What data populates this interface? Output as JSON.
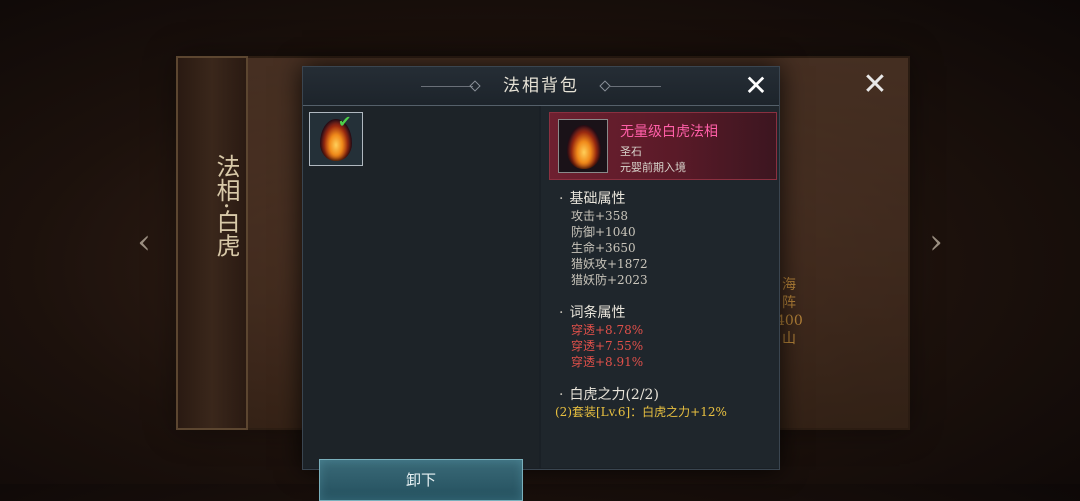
{
  "background": {
    "scroll_title": "法相·白虎",
    "side_text": "海阵400山"
  },
  "dialog": {
    "title": "法相背包",
    "unequip_label": "卸下"
  },
  "item": {
    "name": "无量级白虎法相",
    "type": "圣石",
    "requirement": "元婴前期入境",
    "name_color": "#ff5fa8"
  },
  "base_attributes": {
    "title": "基础属性",
    "stats": [
      "攻击+358",
      "防御+1040",
      "生命+3650",
      "猎妖攻+1872",
      "猎妖防+2023"
    ]
  },
  "affix_attributes": {
    "title": "词条属性",
    "stats": [
      "穿透+8.78%",
      "穿透+7.55%",
      "穿透+8.91%"
    ],
    "color": "#e0504a"
  },
  "set_bonus": {
    "title": "白虎之力(2/2)",
    "line1": "(2)套装[Lv.6]：白虎之力+12%",
    "color": "#e8c040"
  },
  "icons": [
    "close-icon",
    "left-arrow-icon",
    "right-arrow-icon",
    "check-icon",
    "egg-icon"
  ]
}
